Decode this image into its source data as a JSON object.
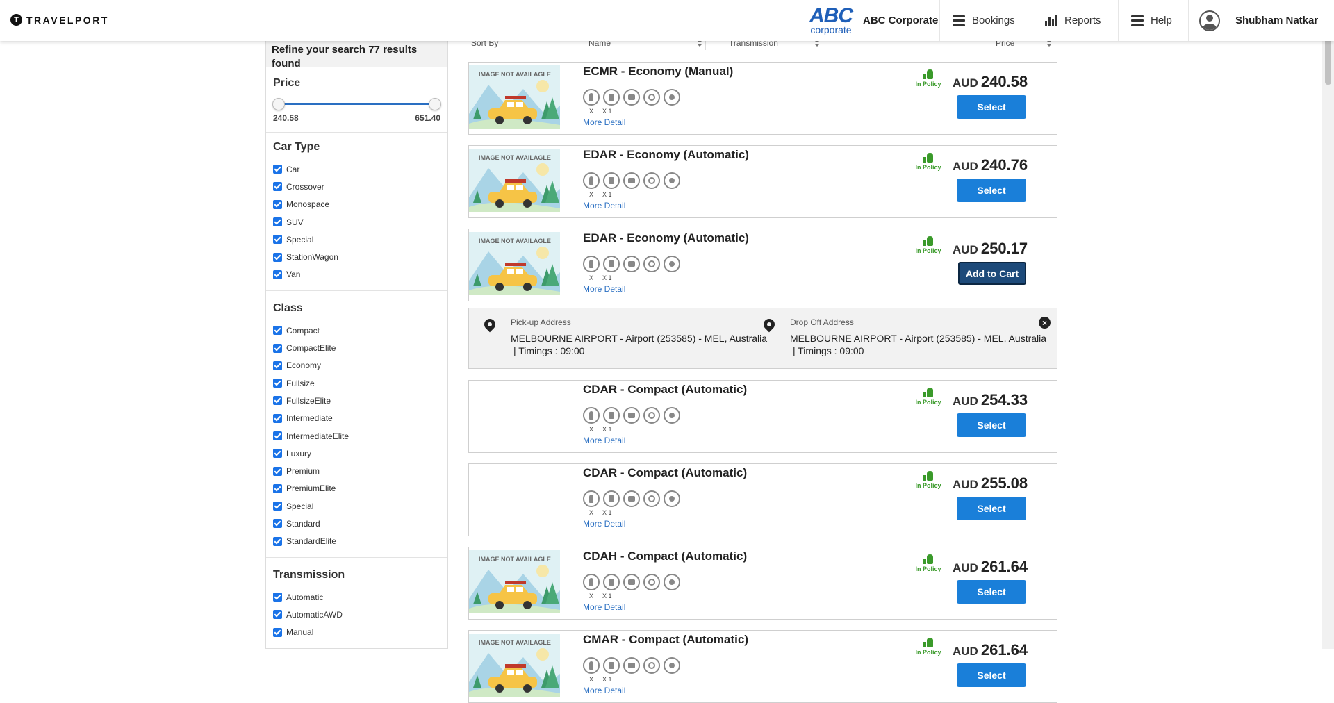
{
  "header": {
    "brand": "TRAVELPORT",
    "brand_mark": "T",
    "corp_logo_main": "ABC",
    "corp_logo_sub": "corporate",
    "corp_name": "ABC Corporate",
    "nav": [
      {
        "label": "Bookings",
        "icon": "menu-icon"
      },
      {
        "label": "Reports",
        "icon": "bar-chart-icon"
      },
      {
        "label": "Help",
        "icon": "menu-icon"
      }
    ],
    "user_name": "Shubham Natkar"
  },
  "sidebar": {
    "heading": "Refine your search 77 results found",
    "price": {
      "title": "Price",
      "min": "240.58",
      "max": "651.40"
    },
    "car_type": {
      "title": "Car Type",
      "options": [
        "Car",
        "Crossover",
        "Monospace",
        "SUV",
        "Special",
        "StationWagon",
        "Van"
      ]
    },
    "class": {
      "title": "Class",
      "options": [
        "Compact",
        "CompactElite",
        "Economy",
        "Fullsize",
        "FullsizeElite",
        "Intermediate",
        "IntermediateElite",
        "Luxury",
        "Premium",
        "PremiumElite",
        "Special",
        "Standard",
        "StandardElite"
      ]
    },
    "transmission": {
      "title": "Transmission",
      "options": [
        "Automatic",
        "AutomaticAWD",
        "Manual"
      ]
    }
  },
  "sortbar": {
    "sort_by": "Sort By",
    "name": "Name",
    "transmission": "Transmission",
    "price": "Price"
  },
  "common": {
    "image_na": "IMAGE NOT AVAILAGLE",
    "in_policy": "In Policy",
    "more_detail": "More Detail",
    "currency": "AUD",
    "pax_label": "X",
    "bag_label": "X 1",
    "select": "Select",
    "add_to_cart": "Add to Cart"
  },
  "results": [
    {
      "title": "ECMR - Economy (Manual)",
      "price": "240.58",
      "has_image": true,
      "action": "Select"
    },
    {
      "title": "EDAR - Economy (Automatic)",
      "price": "240.76",
      "has_image": true,
      "action": "Select"
    },
    {
      "title": "EDAR - Economy (Automatic)",
      "price": "250.17",
      "has_image": true,
      "action": "Add to Cart"
    },
    {
      "title": "CDAR - Compact (Automatic)",
      "price": "254.33",
      "has_image": false,
      "action": "Select"
    },
    {
      "title": "CDAR - Compact (Automatic)",
      "price": "255.08",
      "has_image": false,
      "action": "Select"
    },
    {
      "title": "CDAH - Compact (Automatic)",
      "price": "261.64",
      "has_image": true,
      "action": "Select"
    },
    {
      "title": "CMAR - Compact (Automatic)",
      "price": "261.64",
      "has_image": true,
      "action": "Select"
    }
  ],
  "expanded": {
    "pickup_label": "Pick-up Address",
    "pickup_address": "MELBOURNE AIRPORT - Airport (253585) - MEL, Australia",
    "pickup_time": "| Timings : 09:00",
    "dropoff_label": "Drop Off Address",
    "dropoff_address": "MELBOURNE AIRPORT - Airport (253585) - MEL, Australia",
    "dropoff_time": "| Timings : 09:00"
  }
}
